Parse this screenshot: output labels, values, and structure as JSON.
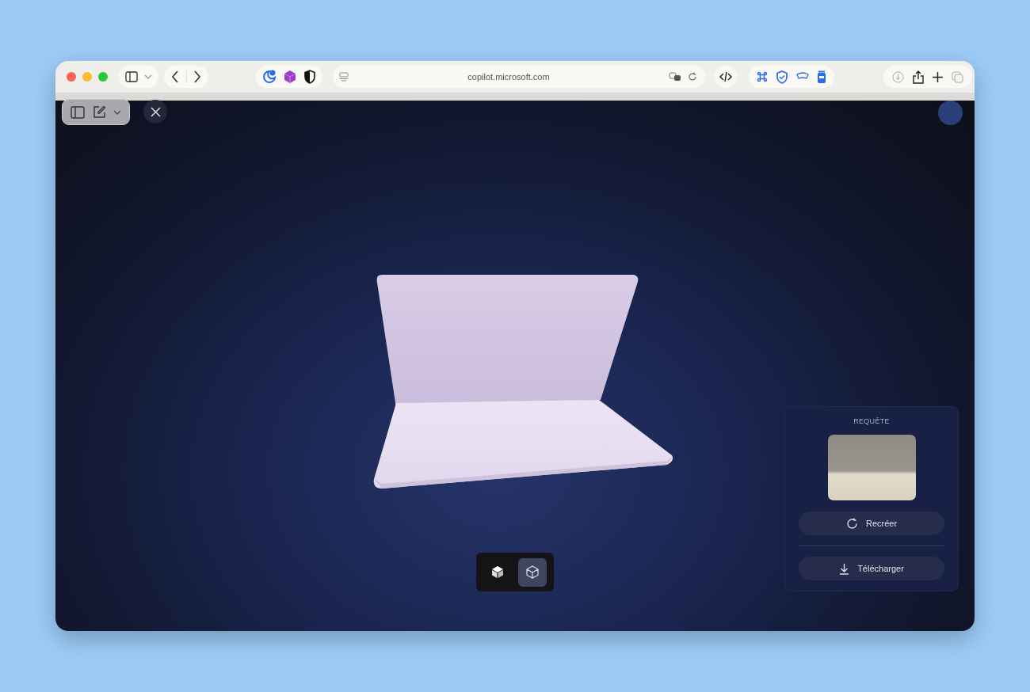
{
  "browser": {
    "url": "copilot.microsoft.com"
  },
  "view_modes": [
    {
      "kind": "solid",
      "selected": false
    },
    {
      "kind": "wireframe",
      "selected": true
    }
  ],
  "panel": {
    "title": "REQUÊTE",
    "actions": [
      {
        "kind": "recreate",
        "label": "Recréer"
      },
      {
        "kind": "download",
        "label": "Télécharger"
      }
    ]
  }
}
